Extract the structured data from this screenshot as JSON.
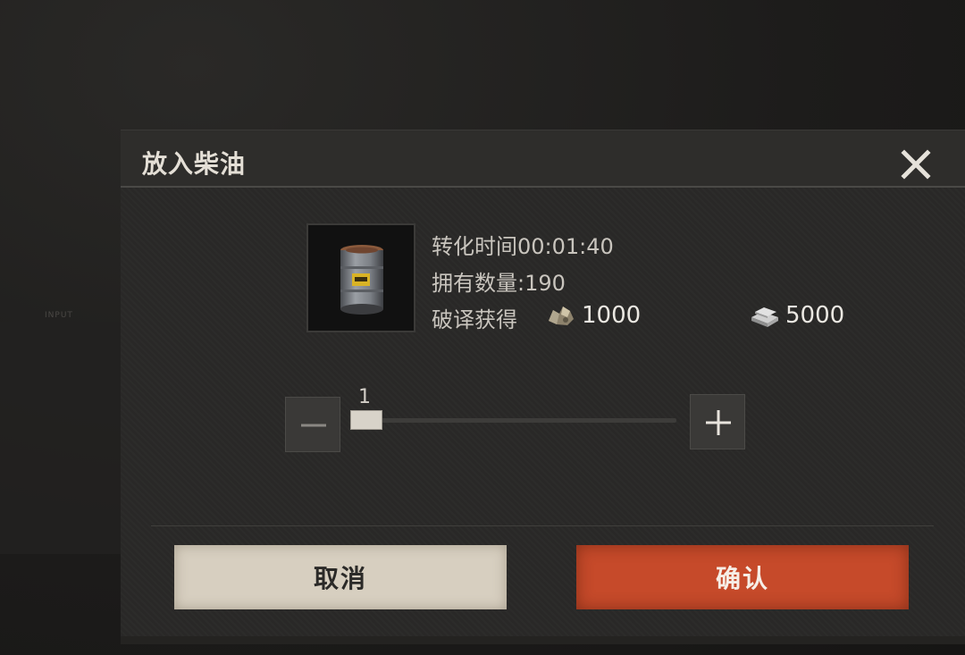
{
  "dialog": {
    "title": "放入柴油",
    "close_icon": "close-icon"
  },
  "item": {
    "icon": "oil-barrel-icon",
    "conversion_time": "转化时间00:01:40",
    "owned_quantity": "拥有数量:190",
    "decode_label": "破译获得",
    "rewards": [
      {
        "icon": "scrap-metal-icon",
        "amount": "1000"
      },
      {
        "icon": "steel-bars-icon",
        "amount": "5000"
      }
    ]
  },
  "quantity": {
    "value": "1",
    "decrease_icon": "minus-icon",
    "increase_icon": "plus-icon",
    "fraction": 0
  },
  "buttons": {
    "cancel_label": "取消",
    "confirm_label": "确认"
  },
  "colors": {
    "confirm": "#c64a2a",
    "cancel": "#d7cfc0",
    "panel": "#2a2928"
  }
}
